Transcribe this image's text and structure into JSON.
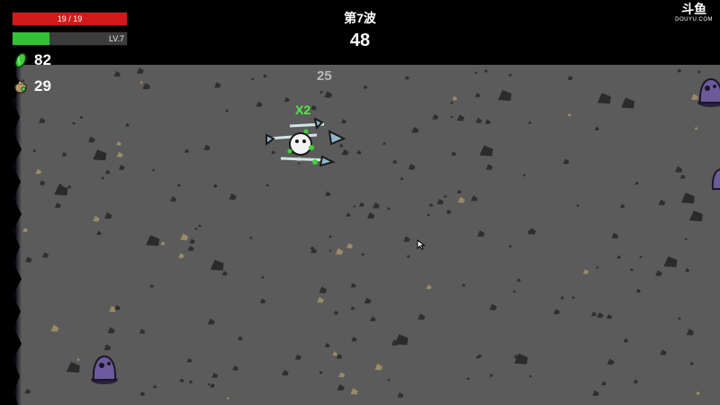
{
  "hud": {
    "hp": {
      "text": "19 / 19",
      "current": 19,
      "max": 19,
      "color": "#d11a1a"
    },
    "xp": {
      "level_text": "LV.7",
      "progress": 0.32,
      "color": "#33c136"
    },
    "materials": {
      "value": "82",
      "icon": "green-material-icon"
    },
    "bag": {
      "value": "29",
      "icon": "material-bag-icon"
    }
  },
  "wave": {
    "label": "第7波",
    "timer": "48"
  },
  "watermark": {
    "main": "斗鱼",
    "sub": "DOUYU.COM"
  },
  "floating": {
    "damage": "25",
    "combo": "X2"
  },
  "colors": {
    "floor": "#5b5b5b",
    "enemy": "#6b5b9a",
    "combo": "#54e84a"
  },
  "entities": {
    "player": "potato-player-with-weapons",
    "enemies": [
      "purple-alien-enemy",
      "purple-alien-enemy",
      "purple-alien-enemy"
    ]
  }
}
